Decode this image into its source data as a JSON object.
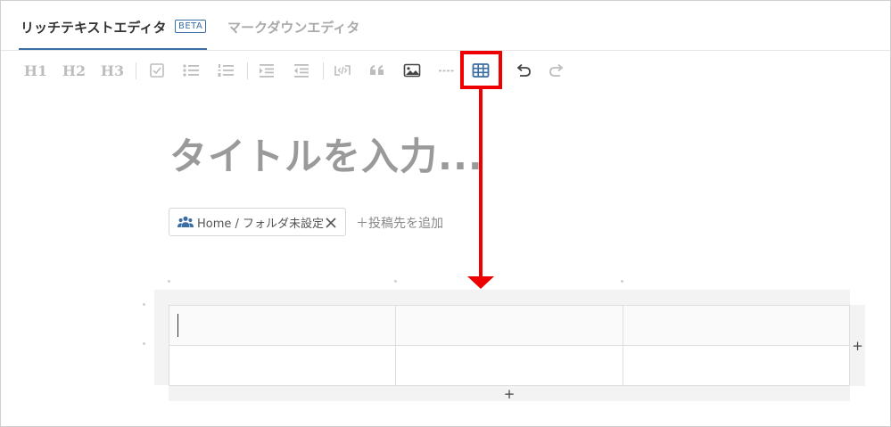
{
  "tabs": {
    "rich_text": "リッチテキストエディタ",
    "beta": "BETA",
    "markdown": "マークダウンエディタ"
  },
  "toolbar": {
    "h1": "H1",
    "h2": "H2",
    "h3": "H3",
    "icons": [
      "checkbox-icon",
      "bullet-list-icon",
      "numbered-list-icon",
      "indent-icon",
      "outdent-icon",
      "code-icon",
      "quote-icon",
      "image-icon",
      "horizontal-rule-icon",
      "table-icon",
      "undo-icon",
      "redo-icon"
    ]
  },
  "editor": {
    "title_placeholder": "タイトルを入力..."
  },
  "folder_chip": {
    "icon": "users-icon",
    "label": "Home / フォルダ未設定"
  },
  "add_destination": "＋投稿先を追加",
  "table": {
    "add_column": "+",
    "add_row": "+"
  },
  "colors": {
    "accent": "#3a6ea5",
    "highlight": "#ee0000",
    "toolbar_disabled": "#bdbdbd",
    "toolbar_active": "#444444"
  }
}
